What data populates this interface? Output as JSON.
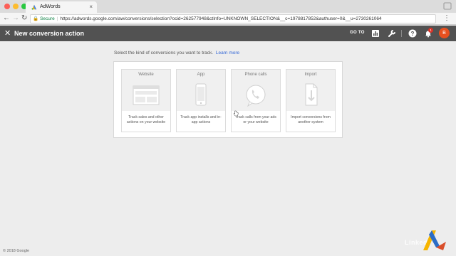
{
  "browser": {
    "tab_title": "AdWords",
    "secure_label": "Secure",
    "url": "https://adwords.google.com/aw/conversions/selection?ocid=262577948&ctInfo=UNKNOWN_SELECTION&__c=1978817852&authuser=0&__u=2730261064"
  },
  "header": {
    "title": "New conversion action",
    "goto_label": "GO TO",
    "notification_count": "1",
    "avatar_letter": "B"
  },
  "content": {
    "prompt": "Select the kind of conversions you want to track.",
    "learn_more": "Learn more",
    "cards": [
      {
        "title": "Website",
        "description": "Track sales and other actions on your website"
      },
      {
        "title": "App",
        "description": "Track app installs and in-app actions"
      },
      {
        "title": "Phone calls",
        "description": "Track calls from your ads or your website"
      },
      {
        "title": "Import",
        "description": "Import conversions from another system"
      }
    ]
  },
  "footer": {
    "copyright": "© 2018 Google"
  },
  "watermark": "Linked"
}
